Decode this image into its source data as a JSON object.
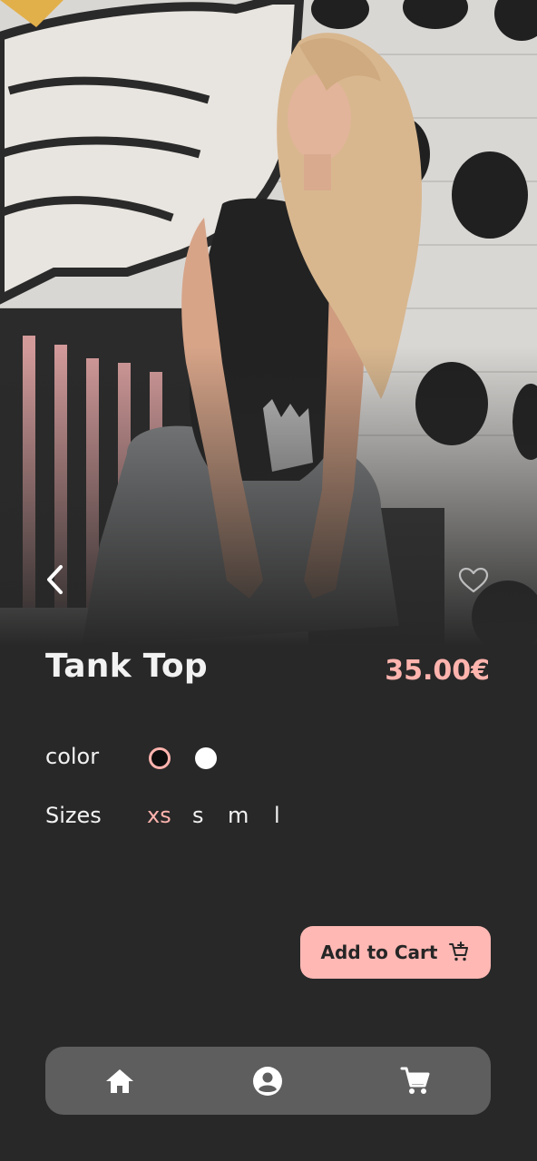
{
  "product": {
    "title": "Tank Top",
    "price": "35.00€"
  },
  "options": {
    "color_label": "color",
    "colors": [
      {
        "name": "black",
        "hex": "#0d0d0d",
        "selected": true
      },
      {
        "name": "white",
        "hex": "#ffffff",
        "selected": false
      }
    ],
    "sizes_label": "Sizes",
    "sizes": [
      "xs",
      "s",
      "m",
      "l"
    ],
    "selected_size": "xs"
  },
  "actions": {
    "add_to_cart_label": "Add to Cart"
  },
  "icons": {
    "back": "chevron-left-icon",
    "favorite": "heart-outline-icon",
    "cart_add": "add-shopping-cart-icon",
    "nav_home": "home-icon",
    "nav_profile": "account-circle-icon",
    "nav_cart": "shopping-cart-icon"
  },
  "colors": {
    "background": "#282828",
    "accent": "#ffb4ae",
    "button": "#ffb8b4",
    "nav_bar": "#5e5e5e",
    "text": "#f2f2f2"
  }
}
